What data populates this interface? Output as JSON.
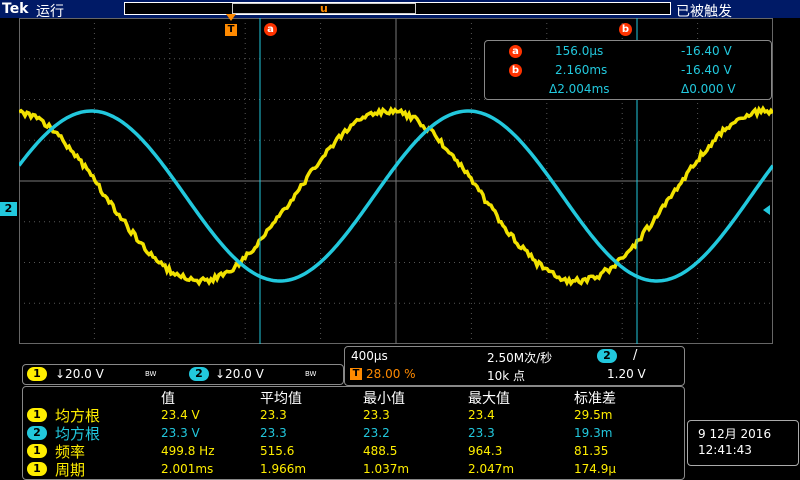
{
  "topbar": {
    "brand": "Tek",
    "run_state": "运行",
    "trigger_state": "已被触发"
  },
  "markers": {
    "trigger": "T",
    "pos_trigger": "u",
    "cursor_a": "a",
    "cursor_b": "b",
    "ch2_ref": "2"
  },
  "cursors": {
    "a_time": "156.0µs",
    "a_value": "-16.40 V",
    "b_time": "2.160ms",
    "b_value": "-16.40 V",
    "delta_time": "Δ2.004ms",
    "delta_value": "Δ0.000 V"
  },
  "channels": [
    {
      "num": "1",
      "scale": "↓20.0 V",
      "bw": "BW",
      "color": "#ffee00"
    },
    {
      "num": "2",
      "scale": "↓20.0 V",
      "bw": "BW",
      "color": "#22c8dd"
    }
  ],
  "horizontal": {
    "timebase": "400µs",
    "sample_rate": "2.50M次/秒",
    "trig_source": "2",
    "trig_slope": "/",
    "trig_pos": "28.00 %",
    "record_length": "10k 点",
    "trig_level": "1.20 V"
  },
  "measurements": {
    "headers": [
      "值",
      "平均值",
      "最小值",
      "最大值",
      "标准差"
    ],
    "rows": [
      {
        "ch": "1",
        "name": "均方根",
        "values": [
          "23.4 V",
          "23.3",
          "23.3",
          "23.4",
          "29.5m"
        ]
      },
      {
        "ch": "2",
        "name": "均方根",
        "values": [
          "23.3 V",
          "23.3",
          "23.2",
          "23.3",
          "19.3m"
        ]
      },
      {
        "ch": "1",
        "name": "频率",
        "values": [
          "499.8 Hz",
          "515.6",
          "488.5",
          "964.3",
          "81.35"
        ]
      },
      {
        "ch": "1",
        "name": "周期",
        "values": [
          "2.001ms",
          "1.966m",
          "1.037m",
          "2.047m",
          "174.9µ"
        ]
      }
    ]
  },
  "datetime": {
    "date": "9 12月 2016",
    "time": "12:41:43"
  },
  "colors": {
    "ch1": "#ffee00",
    "ch2": "#22c8dd",
    "cursor": "#22c8dd",
    "accent": "#ff3300"
  }
}
